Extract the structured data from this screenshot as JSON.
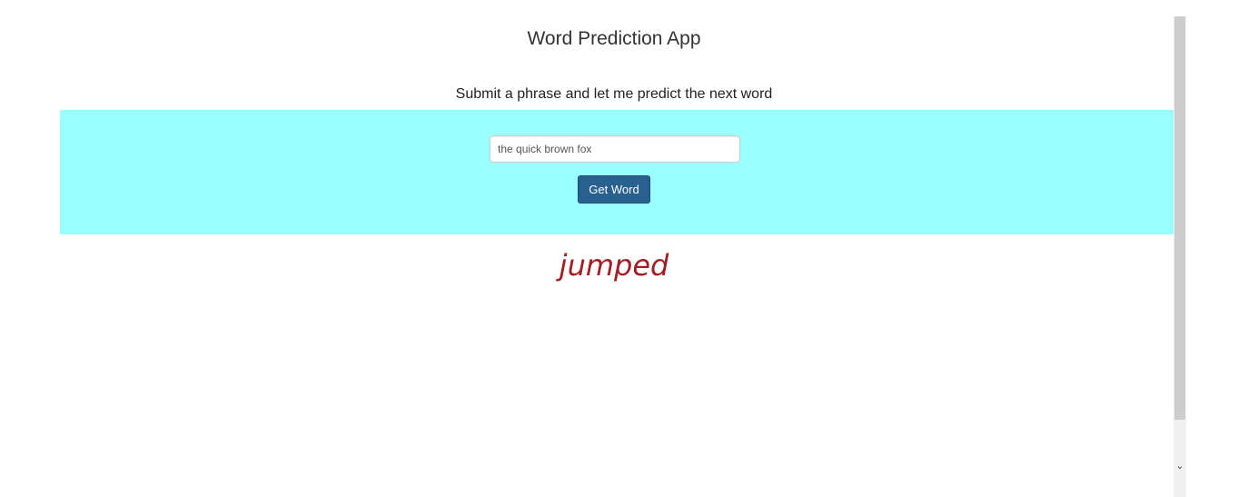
{
  "app": {
    "title": "Word Prediction App",
    "subtitle": "Submit a phrase and let me predict the next word"
  },
  "form": {
    "phrase_value": "the quick brown fox",
    "submit_label": "Get Word",
    "band_color": "#99ffff",
    "button_color": "#286090"
  },
  "result": {
    "predicted_word": "jumped",
    "color": "#a31d25"
  },
  "scrollbar": {
    "down_arrow_icon": "chevron-down-icon",
    "down_arrow_glyph": "⌄"
  }
}
